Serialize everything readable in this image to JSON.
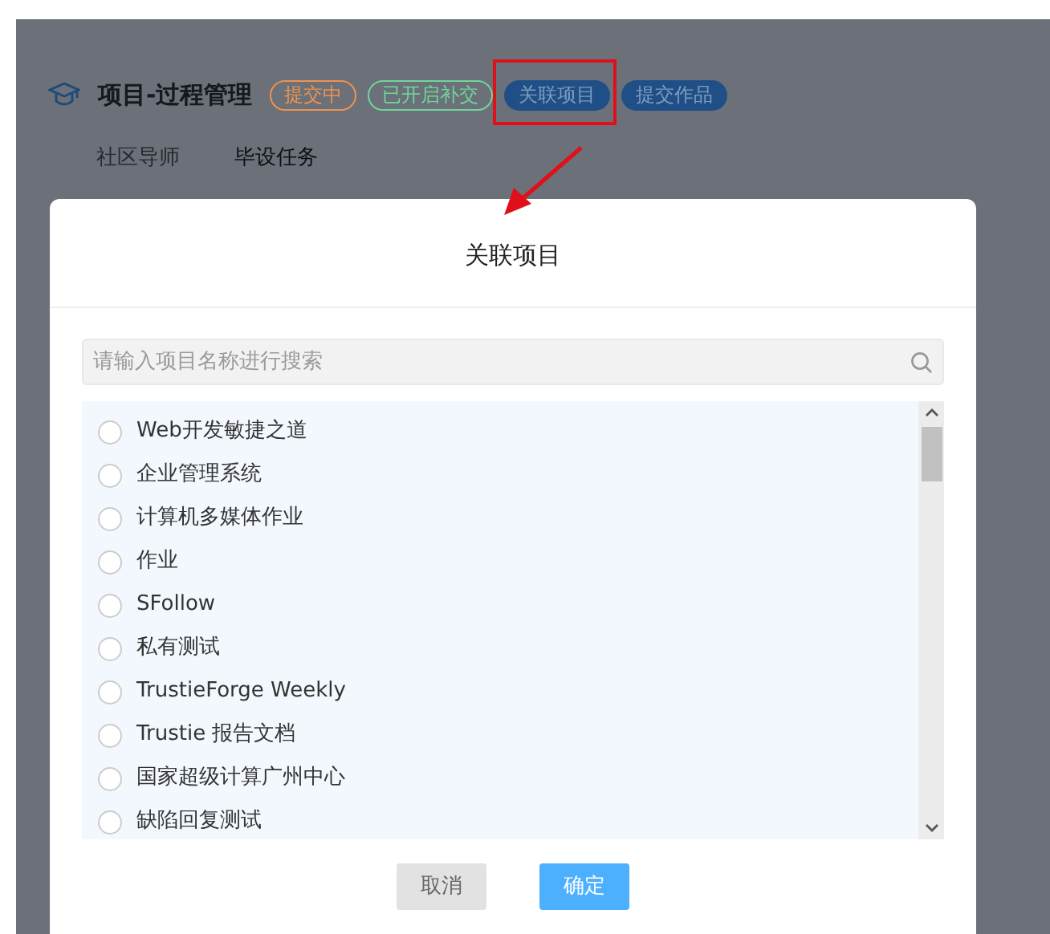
{
  "page": {
    "title": "项目-过程管理",
    "badges": [
      {
        "label": "提交中",
        "kind": "outline",
        "color": "#f0924f",
        "highlighted": false
      },
      {
        "label": "已开启补交",
        "kind": "outline",
        "color": "#6fd69b",
        "highlighted": false
      },
      {
        "label": "关联项目",
        "kind": "filled",
        "color": "#1f4f86",
        "highlighted": true
      },
      {
        "label": "提交作品",
        "kind": "filled",
        "color": "#1f4f86",
        "highlighted": false
      }
    ],
    "tabs": [
      {
        "label": "社区导师",
        "selected": false
      },
      {
        "label": "毕设任务",
        "selected": true
      }
    ]
  },
  "pointer_arrow": true,
  "dialog": {
    "title": "关联项目",
    "search": {
      "placeholder": "请输入项目名称进行搜索"
    },
    "items": [
      {
        "label": "Web开发敏捷之道",
        "selected": false
      },
      {
        "label": "企业管理系统",
        "selected": false
      },
      {
        "label": "计算机多媒体作业",
        "selected": false
      },
      {
        "label": "作业",
        "selected": false
      },
      {
        "label": "SFollow",
        "selected": false
      },
      {
        "label": "私有测试",
        "selected": false
      },
      {
        "label": "TrustieForge Weekly",
        "selected": false
      },
      {
        "label": "Trustie 报告文档",
        "selected": false
      },
      {
        "label": "国家超级计算广州中心",
        "selected": false
      },
      {
        "label": "缺陷回复测试",
        "selected": false
      }
    ],
    "buttons": [
      {
        "label": "取消",
        "kind": "cancel"
      },
      {
        "label": "确定",
        "kind": "primary"
      }
    ]
  }
}
